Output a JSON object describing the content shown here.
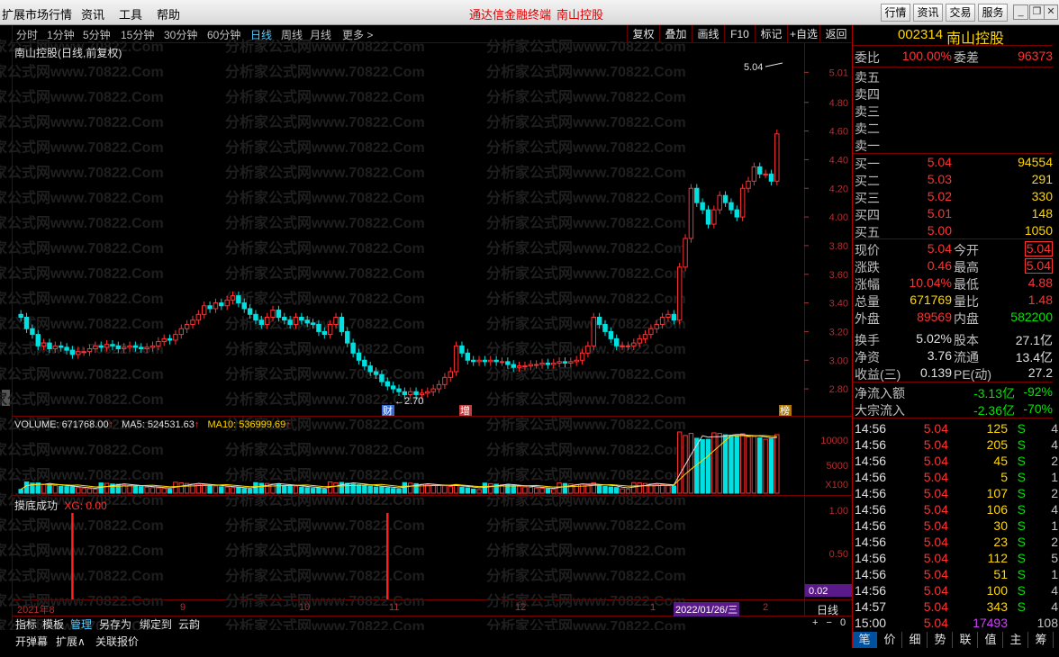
{
  "menubar": {
    "items": [
      "扩展市场行情",
      "资讯",
      "工具",
      "帮助"
    ],
    "title": "通达信金融终端",
    "stock_name": "南山控股",
    "right_buttons": [
      "行情",
      "资讯",
      "交易",
      "服务"
    ]
  },
  "periods": {
    "items": [
      "分时",
      "1分钟",
      "5分钟",
      "15分钟",
      "30分钟",
      "60分钟",
      "日线",
      "周线",
      "月线",
      "更多 >"
    ],
    "active": "日线"
  },
  "tools": [
    "复权",
    "叠加",
    "画线",
    "F10",
    "标记",
    "+自选",
    "返回"
  ],
  "watermark": "分析家公式网www.70822.Com",
  "chart_title": "南山控股(日线,前复权)",
  "chart_data": [
    {
      "type": "candlestick",
      "title": "南山控股(日线,前复权)",
      "ylim": [
        2.7,
        5.1
      ],
      "yticks": [
        "5.01",
        "4.80",
        "4.60",
        "4.40",
        "4.20",
        "4.00",
        "3.80",
        "3.60",
        "3.40",
        "3.20",
        "3.00",
        "2.80"
      ],
      "annotations": {
        "high_label": "5.04",
        "low_label": "2.70",
        "markers": [
          "财",
          "增",
          "榜"
        ]
      },
      "closes": [
        3.3,
        3.22,
        3.18,
        3.1,
        3.12,
        3.08,
        3.1,
        3.09,
        3.07,
        3.04,
        3.06,
        3.06,
        3.08,
        3.1,
        3.09,
        3.11,
        3.1,
        3.08,
        3.09,
        3.1,
        3.09,
        3.08,
        3.09,
        3.1,
        3.13,
        3.15,
        3.14,
        3.18,
        3.22,
        3.25,
        3.28,
        3.32,
        3.38,
        3.36,
        3.4,
        3.38,
        3.42,
        3.45,
        3.4,
        3.36,
        3.32,
        3.28,
        3.25,
        3.3,
        3.35,
        3.3,
        3.28,
        3.25,
        3.3,
        3.28,
        3.26,
        3.25,
        3.2,
        3.18,
        3.25,
        3.3,
        3.2,
        3.12,
        3.05,
        3.0,
        2.96,
        2.92,
        2.9,
        2.85,
        2.82,
        2.8,
        2.78,
        2.76,
        2.78,
        2.76,
        2.77,
        2.78,
        2.8,
        2.83,
        2.88,
        2.92,
        3.1,
        3.05,
        3.0,
        2.99,
        3.0,
        2.99,
        3.0,
        2.99,
        2.99,
        2.97,
        2.95,
        2.96,
        2.96,
        2.97,
        2.97,
        2.98,
        2.97,
        2.98,
        2.99,
        2.98,
        2.99,
        3.0,
        3.05,
        3.1,
        3.3,
        3.25,
        3.2,
        3.15,
        3.1,
        3.1,
        3.1,
        3.12,
        3.15,
        3.18,
        3.22,
        3.25,
        3.3,
        3.32,
        3.28,
        3.65,
        3.85,
        4.2,
        4.1,
        4.05,
        3.95,
        4.05,
        4.15,
        4.1,
        4.05,
        4.0,
        4.2,
        4.25,
        4.35,
        4.3,
        4.3,
        4.25,
        4.58
      ],
      "volume_ticks": [
        "10000",
        "5000",
        "X100"
      ],
      "volume_info": {
        "label": "VOLUME: 671768.00",
        "ma5": "MA5: 524531.63",
        "ma10": "MA10: 536999.69"
      }
    },
    {
      "type": "indicator",
      "title": "摸底成功",
      "series_label": "XG: 0.00",
      "yticks": [
        "1.00",
        "0.50",
        "0.02"
      ],
      "signals": [
        9,
        64
      ]
    }
  ],
  "dates": [
    "2021年8",
    "9",
    "10",
    "11",
    "12",
    "1",
    "2022/01/26/三",
    "2"
  ],
  "period_label": "日线",
  "zoom": [
    "+",
    "−",
    "0"
  ],
  "bottom_tabs": [
    "指标",
    "模板",
    "管理",
    "另存为",
    "绑定到",
    "云韵"
  ],
  "bottom_bar": [
    "开弹幕",
    "扩展∧",
    "关联报价"
  ],
  "quote": {
    "code": "002314",
    "name": "南山控股",
    "webi": "委比",
    "webi_v": "100.00%",
    "weicha": "委差",
    "weicha_v": "96373",
    "sell": [
      "卖五",
      "卖四",
      "卖三",
      "卖二",
      "卖一"
    ],
    "buy": [
      {
        "l": "买一",
        "p": "5.04",
        "v": "94554"
      },
      {
        "l": "买二",
        "p": "5.03",
        "v": "291"
      },
      {
        "l": "买三",
        "p": "5.02",
        "v": "330"
      },
      {
        "l": "买四",
        "p": "5.01",
        "v": "148"
      },
      {
        "l": "买五",
        "p": "5.00",
        "v": "1050"
      }
    ],
    "stats": [
      {
        "l": "现价",
        "v": "5.04",
        "c": "red",
        "l2": "今开",
        "v2": "5.04",
        "c2": "red",
        "box": true
      },
      {
        "l": "涨跌",
        "v": "0.46",
        "c": "red",
        "l2": "最高",
        "v2": "5.04",
        "c2": "red",
        "box": true
      },
      {
        "l": "涨幅",
        "v": "10.04%",
        "c": "red",
        "l2": "最低",
        "v2": "4.88",
        "c2": "red"
      },
      {
        "l": "总量",
        "v": "671769",
        "c": "yel",
        "l2": "量比",
        "v2": "1.48",
        "c2": "red"
      },
      {
        "l": "外盘",
        "v": "89569",
        "c": "red",
        "l2": "内盘",
        "v2": "582200",
        "c2": "grn"
      },
      {
        "l": "换手",
        "v": "5.02%",
        "c": "wht",
        "l2": "股本",
        "v2": "27.1亿",
        "c2": "wht"
      },
      {
        "l": "净资",
        "v": "3.76",
        "c": "wht",
        "l2": "流通",
        "v2": "13.4亿",
        "c2": "wht"
      },
      {
        "l": "收益(三)",
        "v": "0.139",
        "c": "wht",
        "l2": "PE(动)",
        "v2": "27.2",
        "c2": "wht"
      }
    ],
    "flow": [
      {
        "l": "净流入额",
        "v": "-3.13亿",
        "p": "-92%"
      },
      {
        "l": "大宗流入",
        "v": "-2.36亿",
        "p": "-70%"
      }
    ],
    "ticks": [
      {
        "t": "14:56",
        "p": "5.04",
        "v": "125",
        "s": "S",
        "n": "4"
      },
      {
        "t": "14:56",
        "p": "5.04",
        "v": "205",
        "s": "S",
        "n": "4"
      },
      {
        "t": "14:56",
        "p": "5.04",
        "v": "45",
        "s": "S",
        "n": "2"
      },
      {
        "t": "14:56",
        "p": "5.04",
        "v": "5",
        "s": "S",
        "n": "1"
      },
      {
        "t": "14:56",
        "p": "5.04",
        "v": "107",
        "s": "S",
        "n": "2"
      },
      {
        "t": "14:56",
        "p": "5.04",
        "v": "106",
        "s": "S",
        "n": "4"
      },
      {
        "t": "14:56",
        "p": "5.04",
        "v": "30",
        "s": "S",
        "n": "1"
      },
      {
        "t": "14:56",
        "p": "5.04",
        "v": "23",
        "s": "S",
        "n": "2"
      },
      {
        "t": "14:56",
        "p": "5.04",
        "v": "112",
        "s": "S",
        "n": "5"
      },
      {
        "t": "14:56",
        "p": "5.04",
        "v": "51",
        "s": "S",
        "n": "1"
      },
      {
        "t": "14:56",
        "p": "5.04",
        "v": "100",
        "s": "S",
        "n": "4"
      },
      {
        "t": "14:57",
        "p": "5.04",
        "v": "343",
        "s": "S",
        "n": "4"
      },
      {
        "t": "15:00",
        "p": "5.04",
        "v": "17493",
        "s": "",
        "n": "108"
      }
    ],
    "tabs": [
      "笔",
      "价",
      "细",
      "势",
      "联",
      "值",
      "主",
      "筹"
    ]
  }
}
